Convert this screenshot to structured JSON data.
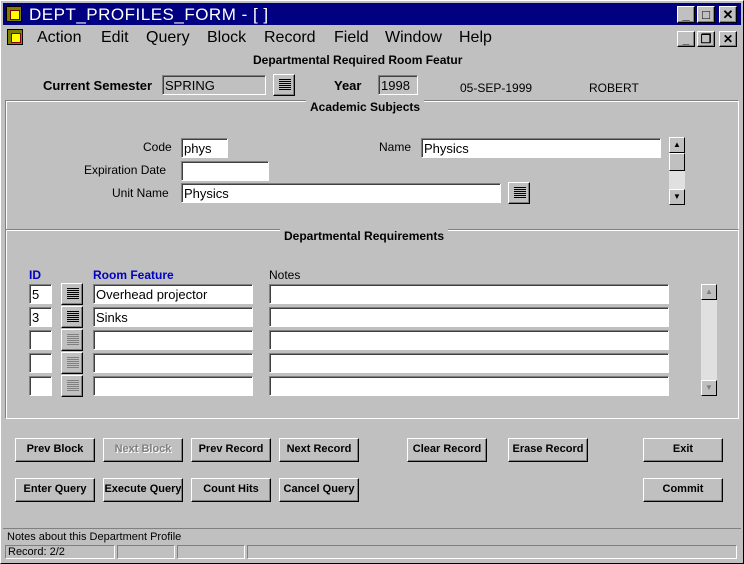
{
  "window": {
    "title": "DEPT_PROFILES_FORM - [ ]"
  },
  "menu": [
    "Action",
    "Edit",
    "Query",
    "Block",
    "Record",
    "Field",
    "Window",
    "Help"
  ],
  "form_title": "Departmental Required Room Featur",
  "header": {
    "semester_label": "Current Semester",
    "semester_value": "SPRING",
    "year_label": "Year",
    "year_value": "1998",
    "date": "05-SEP-1999",
    "user": "ROBERT"
  },
  "subjects": {
    "title": "Academic Subjects",
    "code_label": "Code",
    "code_value": "phys",
    "name_label": "Name",
    "name_value": "Physics",
    "expiration_label": "Expiration Date",
    "expiration_value": "",
    "unit_label": "Unit Name",
    "unit_value": "Physics"
  },
  "requirements": {
    "title": "Departmental Requirements",
    "columns": {
      "id": "ID",
      "feature": "Room Feature",
      "notes": "Notes"
    },
    "rows": [
      {
        "id": "5",
        "feature": "Overhead projector",
        "notes": ""
      },
      {
        "id": "3",
        "feature": "Sinks",
        "notes": ""
      },
      {
        "id": "",
        "feature": "",
        "notes": ""
      },
      {
        "id": "",
        "feature": "",
        "notes": ""
      },
      {
        "id": "",
        "feature": "",
        "notes": ""
      }
    ]
  },
  "buttons": {
    "prev_block": "Prev Block",
    "next_block": "Next Block",
    "prev_record": "Prev Record",
    "next_record": "Next Record",
    "clear_record": "Clear Record",
    "erase_record": "Erase Record",
    "exit": "Exit",
    "enter_query": "Enter Query",
    "execute_query": "Execute Query",
    "count_hits": "Count Hits",
    "cancel_query": "Cancel Query",
    "commit": "Commit"
  },
  "status": {
    "hint": "Notes about this Department Profile",
    "record": "Record: 2/2"
  },
  "icons": {
    "app": "oracle-forms-app-icon",
    "lov": "list-of-values-icon"
  }
}
